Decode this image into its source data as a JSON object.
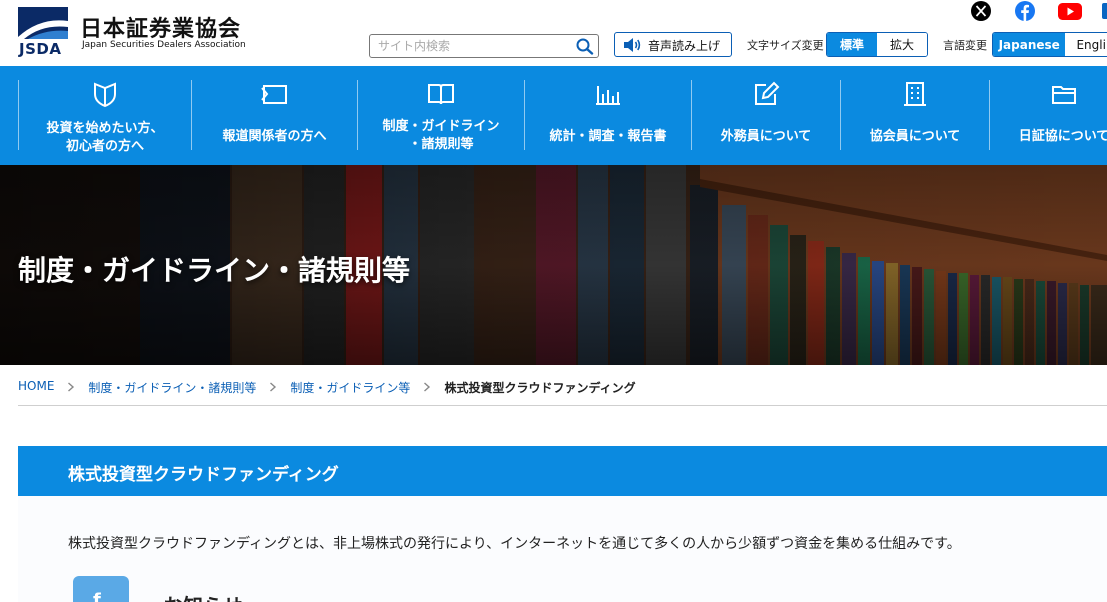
{
  "header": {
    "logo_ja": "日本証券業協会",
    "logo_abbr": "JSDA",
    "logo_en": "Japan Securities Dealers Association",
    "search_placeholder": "サイト内検索",
    "tts_label": "音声読み上げ",
    "font_size": {
      "label": "文字サイズ変更",
      "options": [
        "標準",
        "拡大"
      ],
      "selected": "標準"
    },
    "language": {
      "label": "言語変更",
      "options": [
        "Japanese",
        "Engli"
      ],
      "selected": "Japanese"
    },
    "social": [
      {
        "icon": "x-icon",
        "color": "#000000"
      },
      {
        "icon": "facebook-icon",
        "color": "#1877f2"
      },
      {
        "icon": "youtube-icon",
        "color": "#ff0000"
      }
    ]
  },
  "nav": {
    "items": [
      {
        "label": "投資を始めたい方、\n初心者の方へ",
        "icon": "shield-icon"
      },
      {
        "label": "報道関係者の方へ",
        "icon": "press-icon"
      },
      {
        "label": "制度・ガイドライン\n・諸規則等",
        "icon": "book-icon"
      },
      {
        "label": "統計・調査・報告書",
        "icon": "bar-chart-icon"
      },
      {
        "label": "外務員について",
        "icon": "edit-icon"
      },
      {
        "label": "協会員について",
        "icon": "building-icon"
      },
      {
        "label": "日証協について",
        "icon": "folder-icon"
      }
    ]
  },
  "hero": {
    "title": "制度・ガイドライン・諸規則等"
  },
  "breadcrumb": {
    "items": [
      "HOME",
      "制度・ガイドライン・諸規則等",
      "制度・ガイドライン等",
      "株式投資型クラウドファンディング"
    ]
  },
  "main": {
    "heading": "株式投資型クラウドファンディング",
    "intro": "株式投資型クラウドファンディングとは、非上場株式の発行により、インターネットを通じて多くの人から少額ずつ資金を集める仕組みです。",
    "news_title": "お知らせ"
  },
  "colors": {
    "brand_blue": "#0b8ae0",
    "link_blue": "#0b5fb5",
    "logo_navy": "#0b2a66"
  }
}
